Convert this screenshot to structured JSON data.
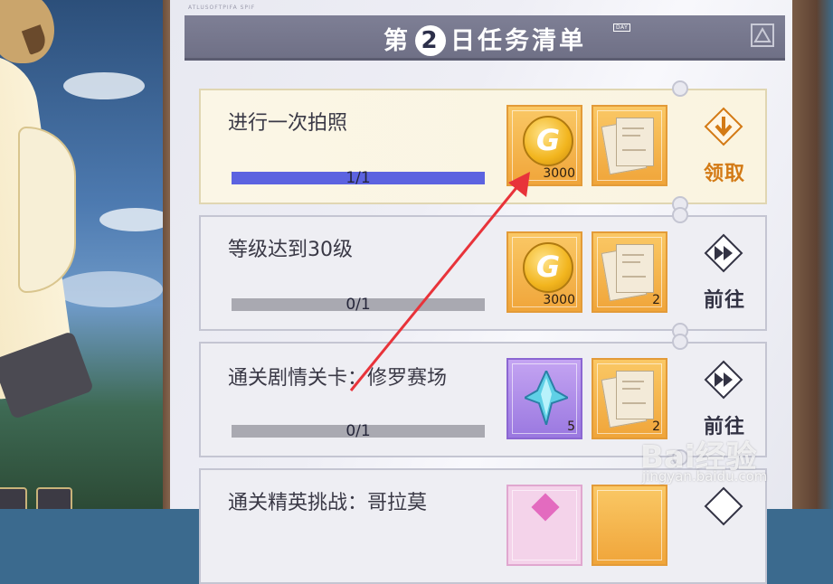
{
  "header": {
    "caption": "ATLUSOFTPIFA  SPIF",
    "title_prefix": "第",
    "day_number": "2",
    "title_suffix": "日任务清单",
    "day_tag": "DAY"
  },
  "tasks": [
    {
      "title": "进行一次拍照",
      "progress_text": "1/1",
      "progress_fraction": 1.0,
      "rewards": [
        {
          "type": "coin",
          "qty": "3000"
        },
        {
          "type": "scroll",
          "qty": ""
        }
      ],
      "action": "领取",
      "action_icon": "download-arrow-icon"
    },
    {
      "title": "等级达到30级",
      "progress_text": "0/1",
      "progress_fraction": 0,
      "rewards": [
        {
          "type": "coin",
          "qty": "3000"
        },
        {
          "type": "scroll",
          "qty": "2"
        }
      ],
      "action": "前往",
      "action_icon": "fast-forward-icon"
    },
    {
      "title": "通关剧情关卡：修罗赛场",
      "progress_text": "0/1",
      "progress_fraction": 0,
      "rewards": [
        {
          "type": "crystal",
          "qty": "5"
        },
        {
          "type": "scroll",
          "qty": "2"
        }
      ],
      "action": "前往",
      "action_icon": "fast-forward-icon"
    },
    {
      "title": "通关精英挑战：哥拉莫",
      "progress_text": "",
      "progress_fraction": 0,
      "rewards": [
        {
          "type": "gem",
          "qty": ""
        },
        {
          "type": "scroll",
          "qty": ""
        }
      ],
      "action": "",
      "action_icon": "diamond-icon"
    }
  ],
  "watermark": {
    "logo": "Bai经验",
    "url": "jingyan.baidu.com"
  },
  "colors": {
    "progress_fill": "#5c63e0",
    "claim_accent": "#d37a15",
    "annotation_arrow": "#e8333a"
  }
}
